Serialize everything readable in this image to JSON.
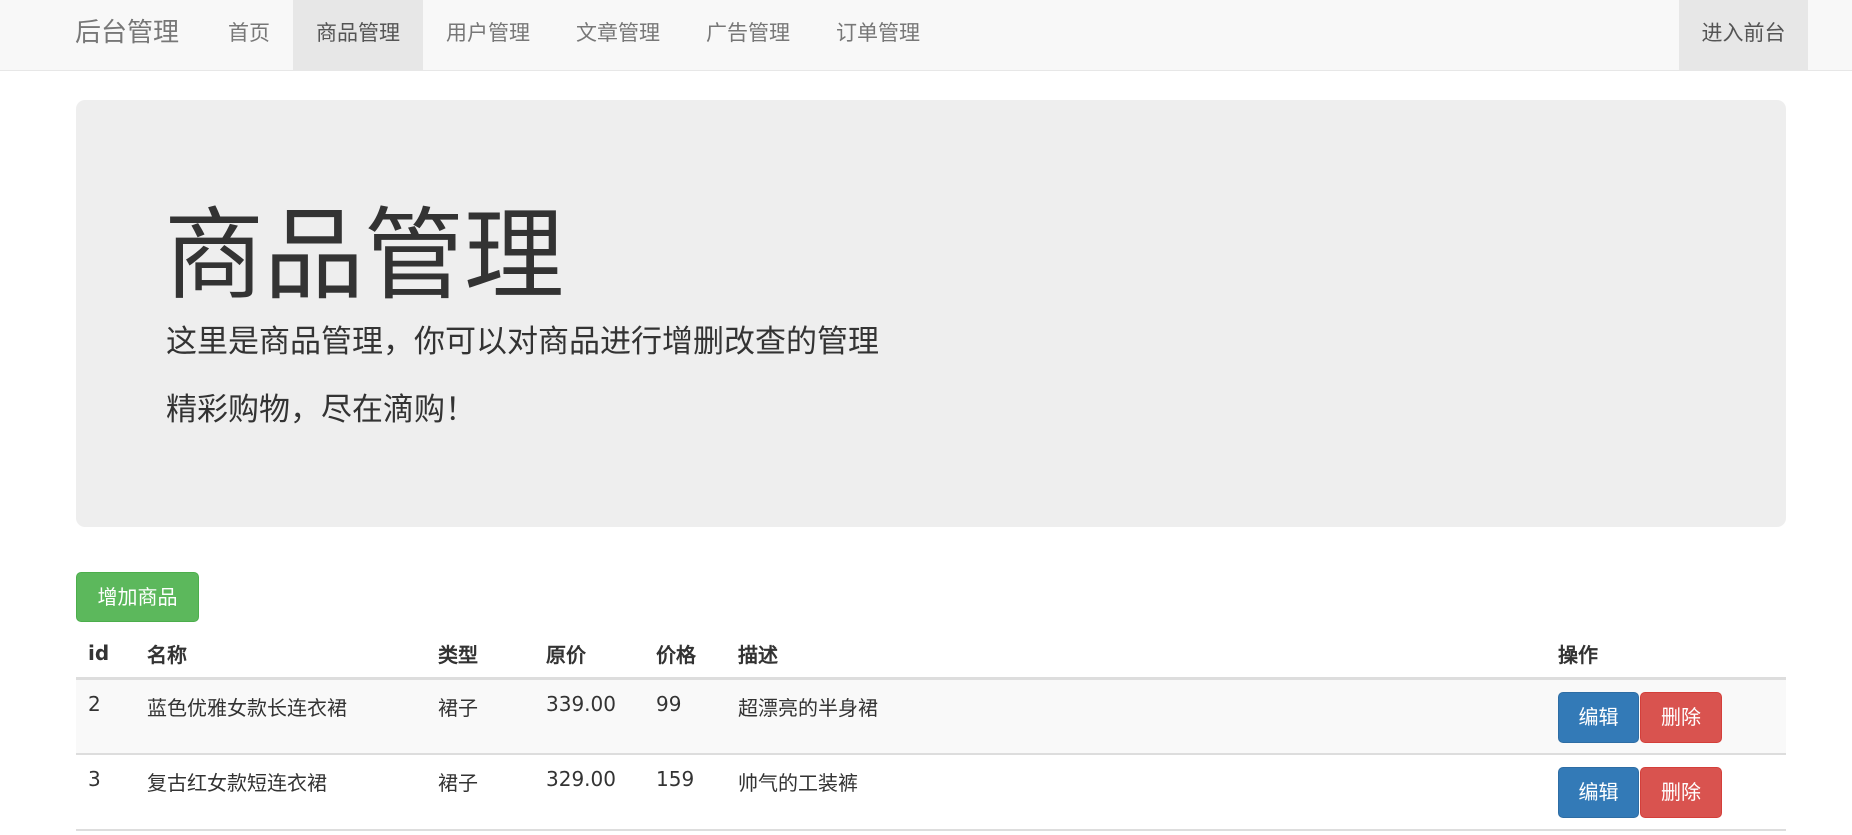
{
  "navbar": {
    "brand": "后台管理",
    "items": [
      {
        "label": "首页",
        "active": false
      },
      {
        "label": "商品管理",
        "active": true
      },
      {
        "label": "用户管理",
        "active": false
      },
      {
        "label": "文章管理",
        "active": false
      },
      {
        "label": "广告管理",
        "active": false
      },
      {
        "label": "订单管理",
        "active": false
      }
    ],
    "right_link": "进入前台"
  },
  "jumbotron": {
    "title": "商品管理",
    "line1": "这里是商品管理，你可以对商品进行增删改查的管理",
    "line2": "精彩购物，尽在滴购！"
  },
  "actions": {
    "add_label": "增加商品"
  },
  "table": {
    "headers": [
      "id",
      "名称",
      "类型",
      "原价",
      "价格",
      "描述",
      "操作"
    ],
    "rows": [
      {
        "id": "2",
        "name": "蓝色优雅女款长连衣裙",
        "type": "裙子",
        "original_price": "339.00",
        "price": "99",
        "description": "超漂亮的半身裙",
        "edit_label": "编辑",
        "delete_label": "删除"
      },
      {
        "id": "3",
        "name": "复古红女款短连衣裙",
        "type": "裙子",
        "original_price": "329.00",
        "price": "159",
        "description": "帅气的工装裤",
        "edit_label": "编辑",
        "delete_label": "删除"
      }
    ]
  },
  "colors": {
    "success": "#5cb85c",
    "primary": "#337ab7",
    "danger": "#d9534f",
    "navbar_bg": "#f8f8f8",
    "jumbotron_bg": "#eeeeee"
  }
}
